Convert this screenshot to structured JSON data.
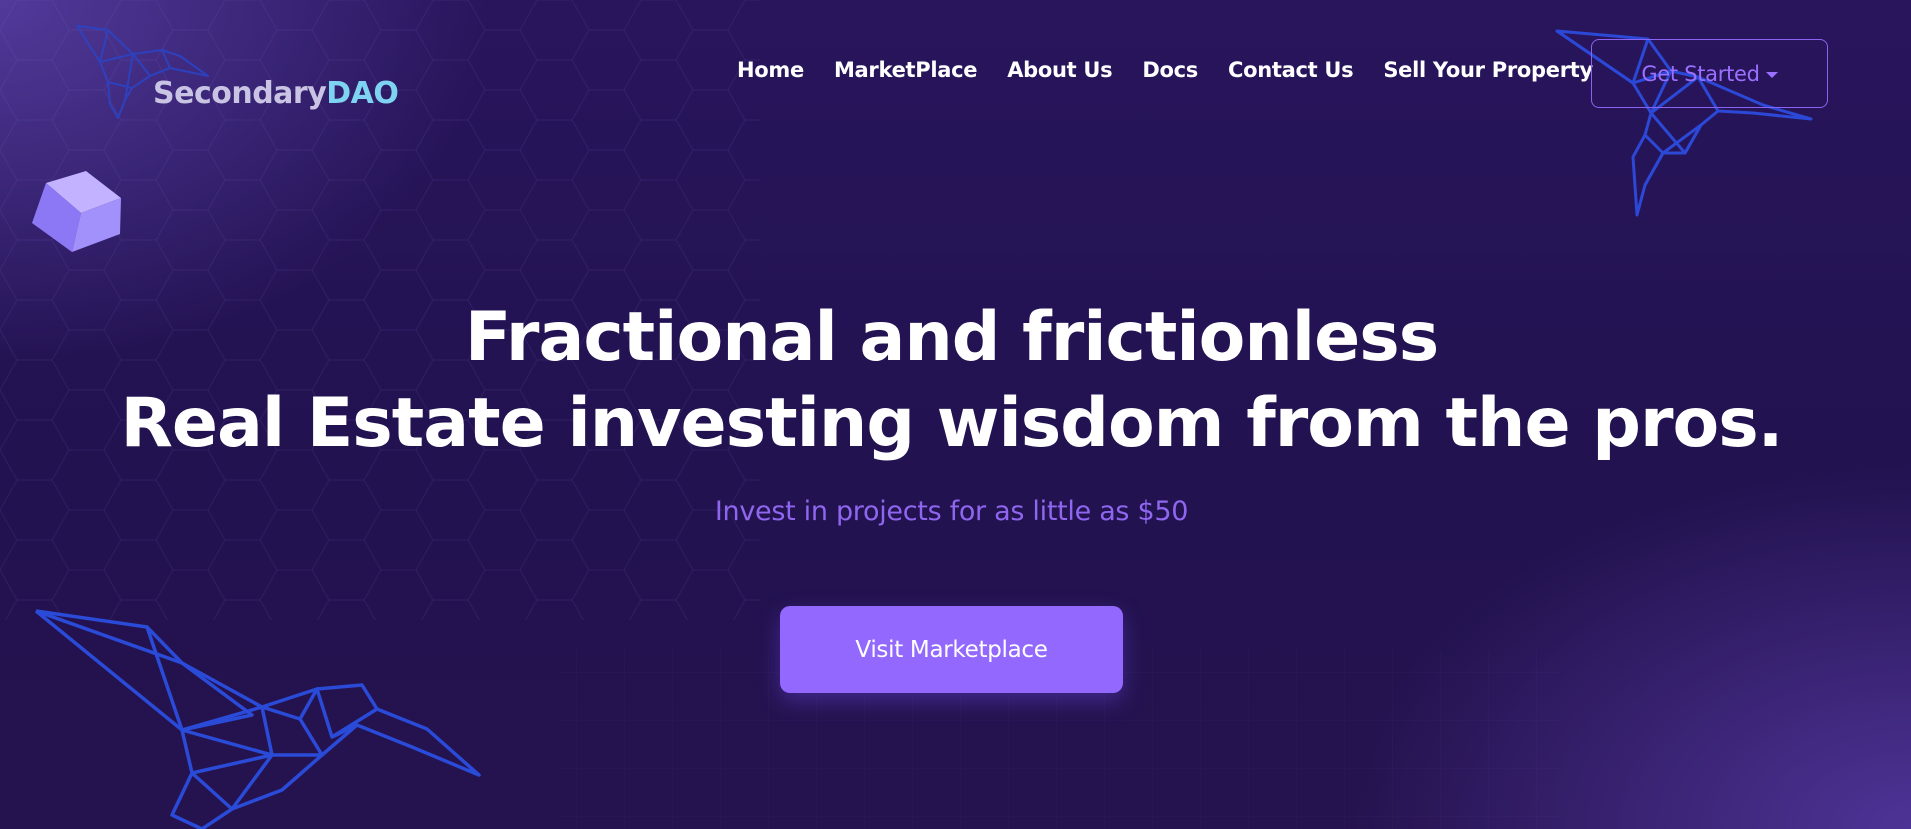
{
  "brand": {
    "logo_part1": "Secondary",
    "logo_part2": "DAO"
  },
  "nav": {
    "items": [
      "Home",
      "MarketPlace",
      "About Us",
      "Docs",
      "Contact Us",
      "Sell Your Property"
    ],
    "get_started_label": "Get Started"
  },
  "hero": {
    "title_line1": "Fractional and frictionless",
    "title_line2": "Real Estate investing wisdom from the pros.",
    "subtitle": "Invest in projects for as little as $50",
    "cta_label": "Visit Marketplace"
  },
  "colors": {
    "background": "#22124f",
    "accent": "#9268ff",
    "subtitle": "#8f66ef",
    "logo_dao": "#7fd3f2",
    "bird_outline": "#2a4ad8",
    "cube": "#8f7cf7"
  },
  "icons": {
    "decor_top_left": "bird-icon",
    "decor_top_right": "bird-icon",
    "decor_bottom_left": "bird-icon",
    "decor_cube": "cube-icon",
    "dropdown": "caret-down-icon"
  }
}
